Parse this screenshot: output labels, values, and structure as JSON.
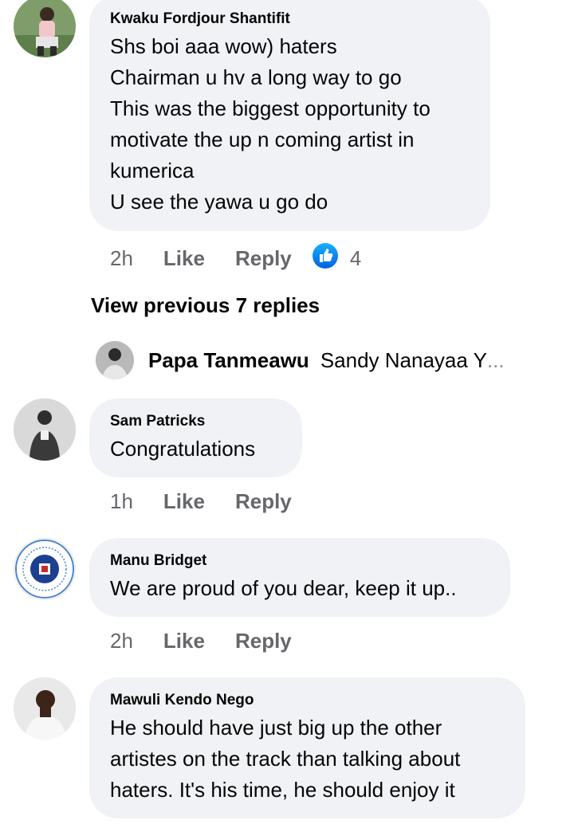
{
  "comments": [
    {
      "name": "Kwaku Fordjour Shantifit",
      "lines": [
        "Shs boi aaa wow) haters",
        "Chairman u hv a long way to go",
        "This was the biggest opportunity to",
        "motivate the up n coming artist in",
        "kumerica",
        "U see the yawa u go do"
      ],
      "time": "2h",
      "like_label": "Like",
      "reply_label": "Reply",
      "reaction_count": "4"
    },
    {
      "name": "Sam Patricks",
      "lines": [
        "Congratulations"
      ],
      "time": "1h",
      "like_label": "Like",
      "reply_label": "Reply"
    },
    {
      "name": "Manu Bridget",
      "lines": [
        "We are proud of you dear, keep it up.."
      ],
      "time": "2h",
      "like_label": "Like",
      "reply_label": "Reply"
    },
    {
      "name": "Mawuli Kendo Nego",
      "lines": [
        "He should have just big up the other",
        "artistes on the track than talking about",
        "haters. It's his time, he should enjoy it"
      ]
    }
  ],
  "view_previous": "View previous 7 replies",
  "reply_preview": {
    "name": "Papa Tanmeawu",
    "text": "Sandy Nanayaa Y",
    "ellipsis": "..."
  },
  "colors": {
    "bubble": "#f0f2f5",
    "meta": "#65676b",
    "like_blue": "#1877f2"
  },
  "icons": {
    "reaction": "like-thumb-icon"
  }
}
